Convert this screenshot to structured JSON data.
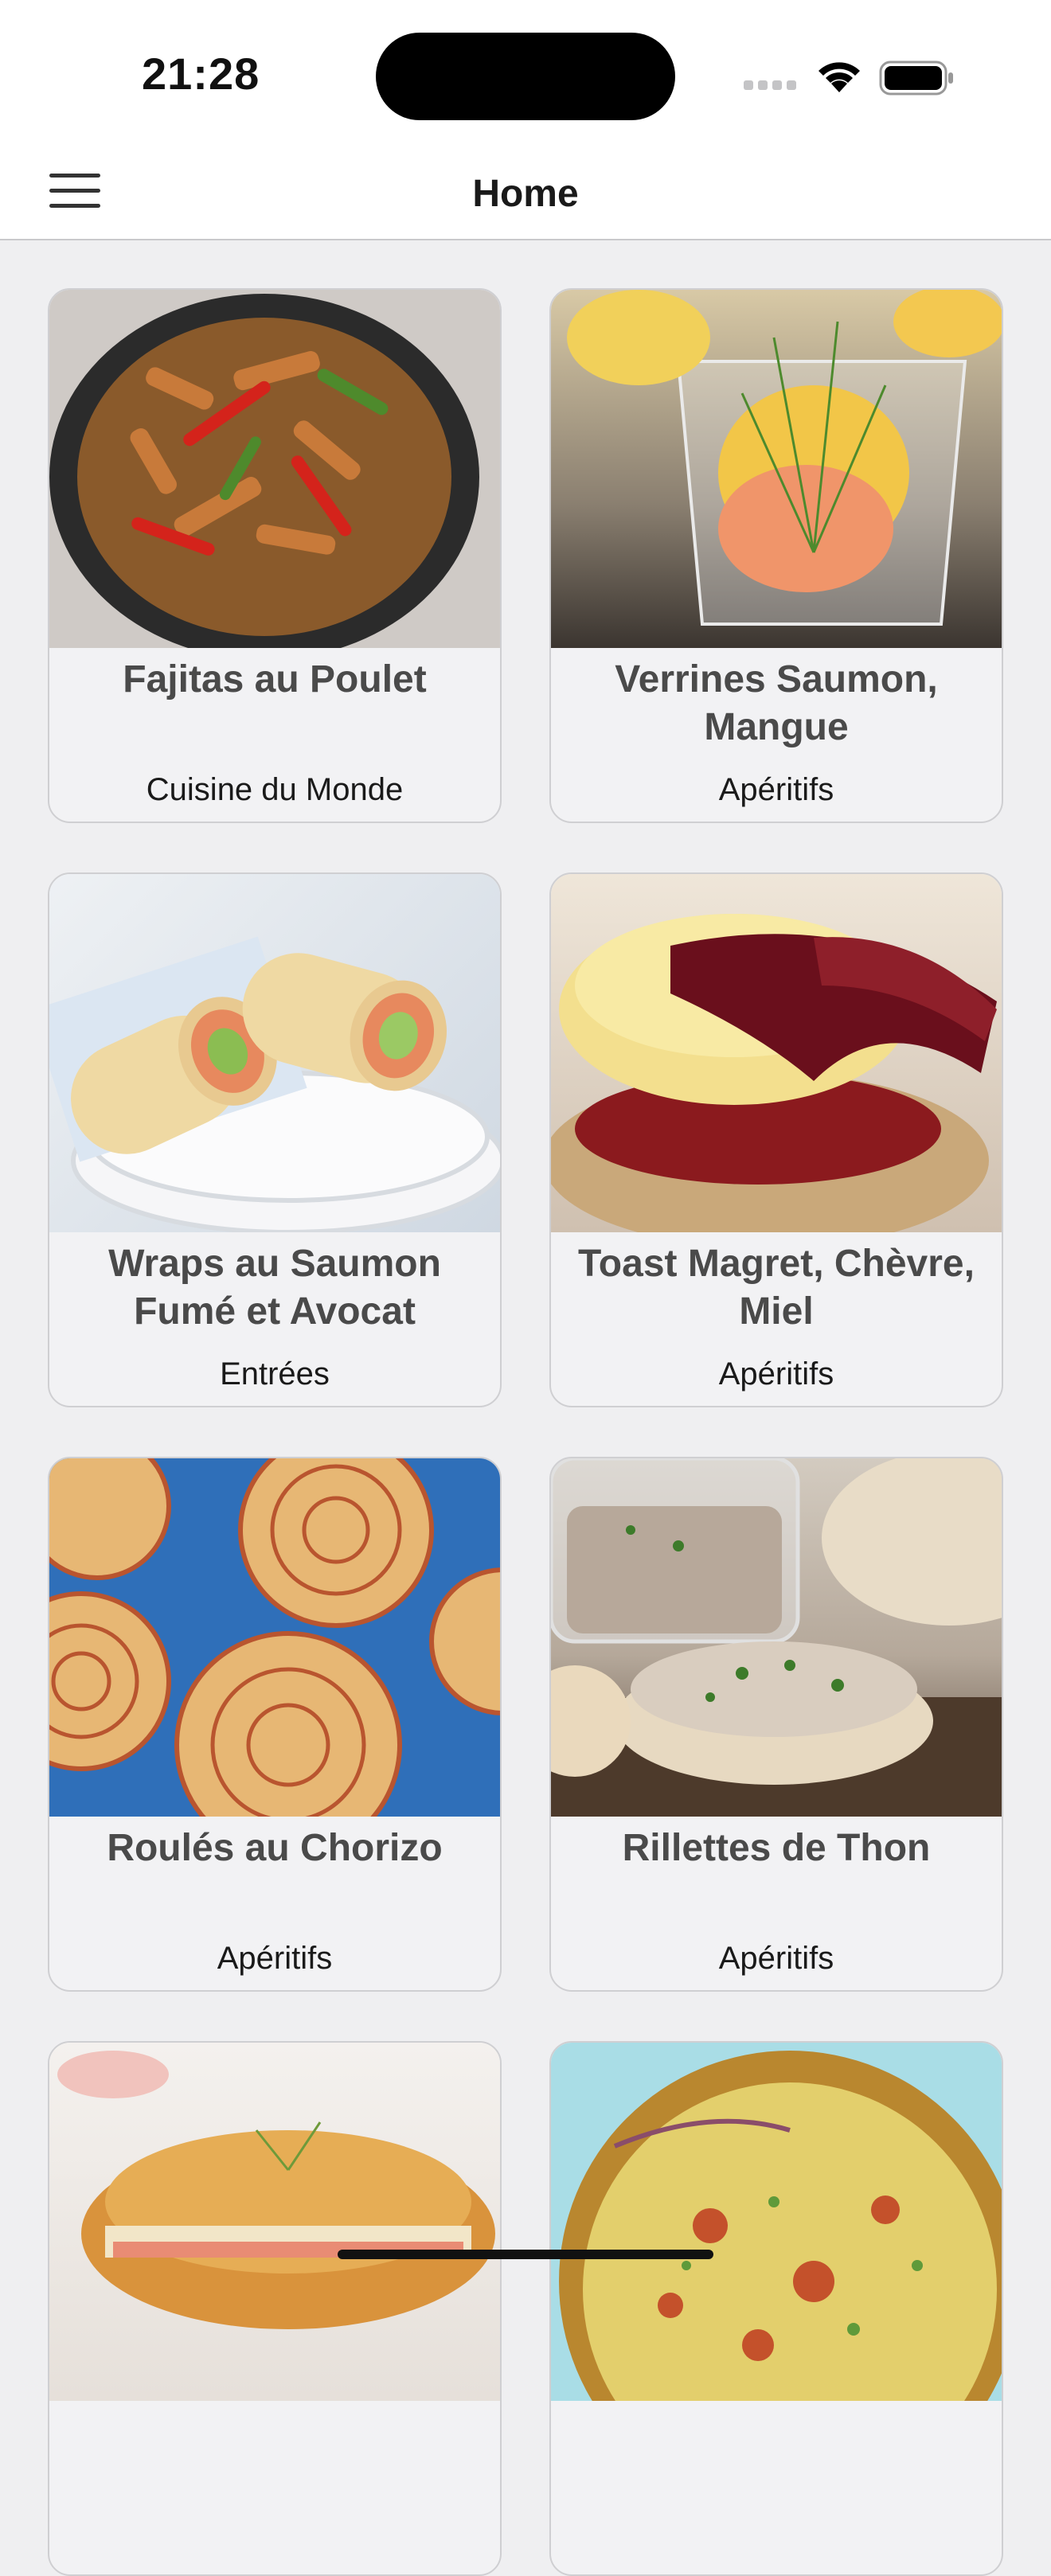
{
  "status_bar": {
    "time": "21:28"
  },
  "navbar": {
    "title": "Home",
    "menu_icon": "hamburger-menu-icon"
  },
  "recipes": [
    {
      "title": "Fajitas au Poulet",
      "category": "Cuisine du Monde"
    },
    {
      "title": "Verrines Saumon, Mangue",
      "category": "Apéritifs"
    },
    {
      "title": "Wraps au Saumon Fumé et Avocat",
      "category": "Entrées"
    },
    {
      "title": "Toast Magret, Chèvre, Miel",
      "category": "Apéritifs"
    },
    {
      "title": "Roulés au Chorizo",
      "category": "Apéritifs"
    },
    {
      "title": "Rillettes de Thon",
      "category": "Apéritifs"
    },
    {
      "title": "",
      "category": ""
    },
    {
      "title": "",
      "category": ""
    }
  ],
  "colors": {
    "background": "#efeff1",
    "card_background": "#f2f2f4",
    "title_text": "#4a4a4a"
  }
}
